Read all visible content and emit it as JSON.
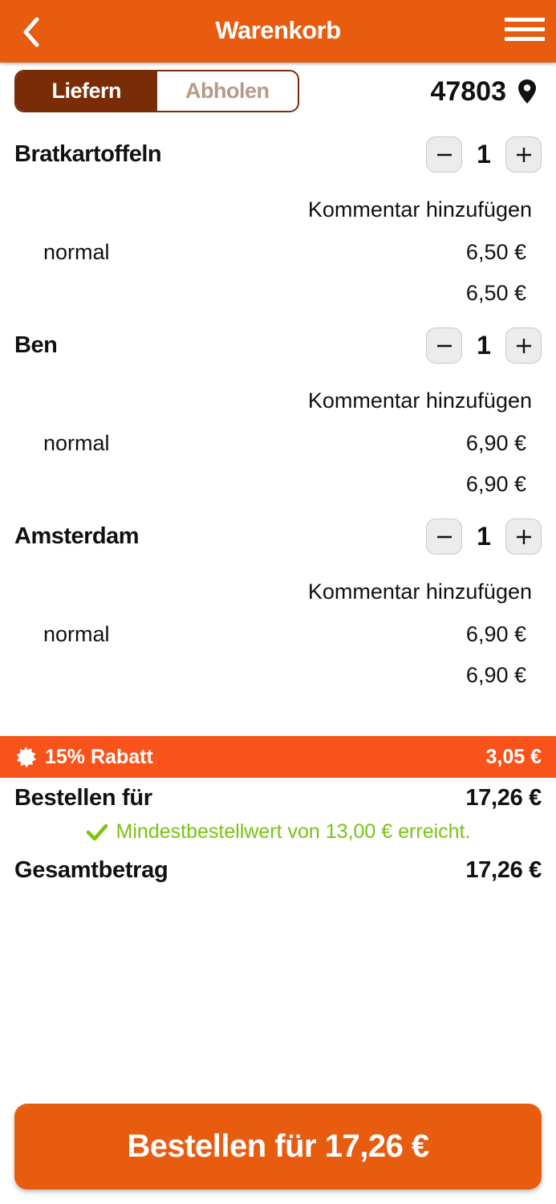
{
  "header": {
    "title": "Warenkorb",
    "back_icon": "chevron-left-icon",
    "menu_icon": "hamburger-menu-icon"
  },
  "delivery_toggle": {
    "options": [
      {
        "label": "Liefern",
        "active": true
      },
      {
        "label": "Abholen",
        "active": false
      }
    ]
  },
  "location": {
    "zip": "47803",
    "icon": "map-pin-icon"
  },
  "items": [
    {
      "name": "Bratkartoffeln",
      "quantity": "1",
      "comment_label": "Kommentar hinzufügen",
      "variant": "normal",
      "variant_price": "6,50 €",
      "total": "6,50 €"
    },
    {
      "name": "Ben",
      "quantity": "1",
      "comment_label": "Kommentar hinzufügen",
      "variant": "normal",
      "variant_price": "6,90 €",
      "total": "6,90 €"
    },
    {
      "name": "Amsterdam",
      "quantity": "1",
      "comment_label": "Kommentar hinzufügen",
      "variant": "normal",
      "variant_price": "6,90 €",
      "total": "6,90 €"
    }
  ],
  "discount": {
    "label": "15% Rabatt",
    "amount": "3,05 €",
    "icon": "badge-icon"
  },
  "summary": {
    "order_for_label": "Bestellen für",
    "order_for_value": "17,26 €",
    "minimum_text": "Mindestbestellwert von 13,00 € erreicht.",
    "minimum_icon": "check-icon",
    "total_label": "Gesamtbetrag",
    "total_value": "17,26 €"
  },
  "cta": {
    "label": "Bestellen für 17,26 €"
  },
  "colors": {
    "primary": "#e85c10",
    "toggle_active": "#7a2c06",
    "discount_bar": "#f9531c",
    "success": "#7ac412"
  }
}
